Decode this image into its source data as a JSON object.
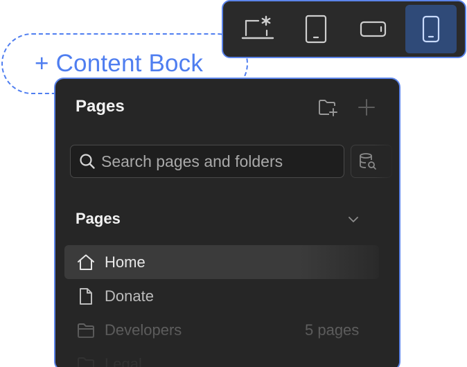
{
  "content_block": {
    "label": "+ Content Bock",
    "color": "#4f7ef0"
  },
  "device_toolbar": {
    "devices": [
      {
        "icon": "desktop-primary-icon",
        "active": false
      },
      {
        "icon": "tablet-icon",
        "active": false
      },
      {
        "icon": "mobile-landscape-icon",
        "active": false
      },
      {
        "icon": "mobile-portrait-icon",
        "active": true
      }
    ],
    "active_color": "#2f4a78"
  },
  "pages_panel": {
    "title": "Pages",
    "header_icons": [
      "new-folder-icon",
      "add-page-icon"
    ],
    "search": {
      "placeholder": "Search pages and folders",
      "value": ""
    },
    "filter_icon": "database-search-icon",
    "section": {
      "title": "Pages",
      "expanded": true
    },
    "items": [
      {
        "label": "Home",
        "icon": "home-icon",
        "selected": true,
        "meta": ""
      },
      {
        "label": "Donate",
        "icon": "page-icon",
        "selected": false,
        "meta": ""
      },
      {
        "label": "Developers",
        "icon": "folder-icon",
        "selected": false,
        "meta": "5 pages"
      },
      {
        "label": "Legal",
        "icon": "folder-icon",
        "selected": false,
        "meta": ""
      }
    ],
    "border_color": "#5b84ea",
    "background_color": "#262626"
  }
}
